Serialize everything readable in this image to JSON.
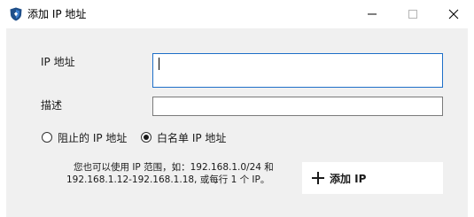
{
  "window": {
    "title": "添加 IP 地址",
    "controls": {
      "minimize_icon": "minimize-icon",
      "maximize_icon": "maximize-icon",
      "close_icon": "close-icon"
    },
    "app_icon": "shield-icon"
  },
  "form": {
    "ip_label": "IP 地址",
    "ip_value": "",
    "description_label": "描述",
    "description_value": ""
  },
  "radio_options": [
    {
      "label": "阻止的 IP 地址",
      "selected": false
    },
    {
      "label": "白名单 IP 地址",
      "selected": true
    }
  ],
  "hint": {
    "line1": "您也可以使用 IP 范围，如：192.168.1.0/24 和",
    "line2": "192.168.1.12-192.168.1.18, 或每行 1 个 IP。"
  },
  "add_button": {
    "label": "添加 IP",
    "icon": "plus-icon"
  },
  "colors": {
    "focus_border": "#1e6fc8",
    "panel_bg": "#f0f0f0",
    "shield_blue": "#1f4f8a"
  }
}
